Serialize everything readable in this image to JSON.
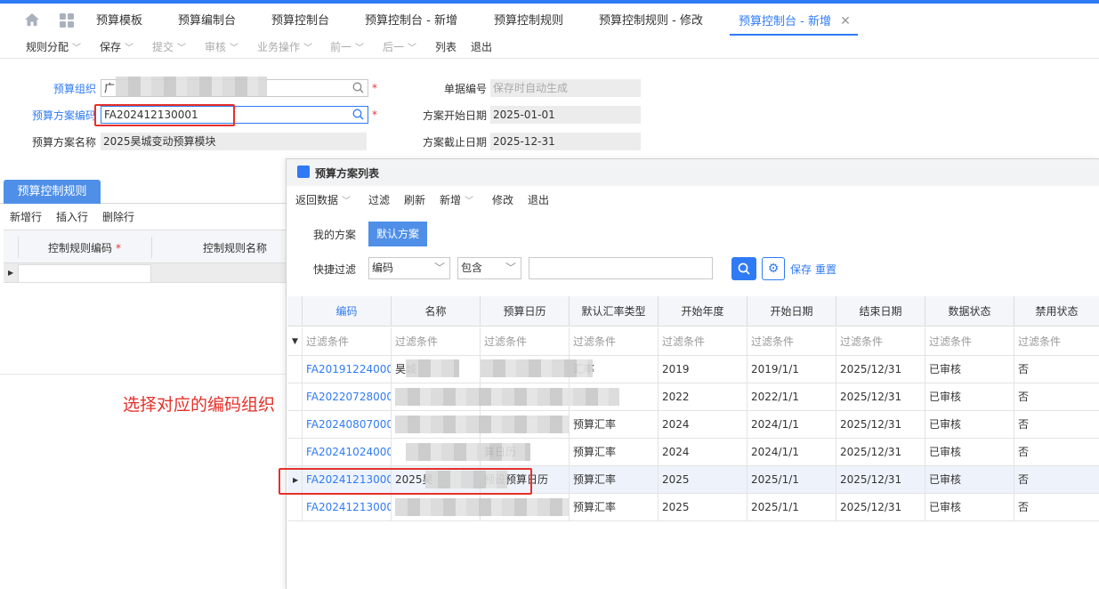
{
  "tabs": [
    {
      "label": "预算模板"
    },
    {
      "label": "预算编制台"
    },
    {
      "label": "预算控制台"
    },
    {
      "label": "预算控制台 - 新增"
    },
    {
      "label": "预算控制规则"
    },
    {
      "label": "预算控制规则 - 修改"
    },
    {
      "label": "预算控制台 - 新增"
    }
  ],
  "toolbar": [
    "规则分配",
    "保存",
    "提交",
    "审核",
    "业务操作",
    "前一",
    "后一",
    "列表",
    "退出"
  ],
  "form": {
    "org_label": "预算组织",
    "org_value": "广",
    "scheme_code_label": "预算方案编码",
    "scheme_code_value": "FA202412130001",
    "scheme_name_label": "预算方案名称",
    "scheme_name_value": "2025昊城变动预算模块",
    "doc_no_label": "单据编号",
    "doc_no_placeholder": "保存时自动生成",
    "start_label": "方案开始日期",
    "start_value": "2025-01-01",
    "end_label": "方案截止日期",
    "end_value": "2025-12-31"
  },
  "left_panel": {
    "tab": "预算控制规则",
    "actions": [
      "新增行",
      "插入行",
      "删除行"
    ],
    "col1": "控制规则编码",
    "col2": "控制规则名称"
  },
  "popup": {
    "title": "预算方案列表",
    "toolbar": [
      "返回数据",
      "过滤",
      "刷新",
      "新增",
      "修改",
      "退出"
    ],
    "scheme_tabs": [
      "我的方案",
      "默认方案"
    ],
    "quick_filter_label": "快捷过滤",
    "field_select": "编码",
    "op_select": "包含",
    "save_link": "保存",
    "reset_link": "重置",
    "filter_placeholder": "过滤条件",
    "columns": [
      "编码",
      "名称",
      "预算日历",
      "默认汇率类型",
      "开始年度",
      "开始日期",
      "结束日期",
      "数据状态",
      "禁用状态"
    ],
    "rows": [
      {
        "code": "FA20191224000",
        "name": "昊城",
        "cal": "",
        "rate": "汇率",
        "year": "2019",
        "start": "2019/1/1",
        "end": "2025/12/31",
        "status": "已审核",
        "disabled": "否"
      },
      {
        "code": "FA20220728000",
        "name": "",
        "cal": "",
        "rate": "",
        "year": "2022",
        "start": "2022/1/1",
        "end": "2025/12/31",
        "status": "已审核",
        "disabled": "否"
      },
      {
        "code": "FA20240807000",
        "name": "",
        "cal": "",
        "rate": "预算汇率",
        "year": "2024",
        "start": "2024/1/1",
        "end": "2025/12/31",
        "status": "已审核",
        "disabled": "否"
      },
      {
        "code": "FA20241024000",
        "name": "",
        "cal": "算日历",
        "rate": "预算汇率",
        "year": "2024",
        "start": "2024/1/1",
        "end": "2025/12/31",
        "status": "已审核",
        "disabled": "否"
      },
      {
        "code": "FA20241213000",
        "name": "2025昊",
        "cal": "预设预算日历",
        "rate": "预算汇率",
        "year": "2025",
        "start": "2025/1/1",
        "end": "2025/12/31",
        "status": "已审核",
        "disabled": "否"
      },
      {
        "code": "FA20241213000",
        "name": "",
        "cal": "",
        "rate": "预算汇率",
        "year": "2025",
        "start": "2025/1/1",
        "end": "2025/12/31",
        "status": "已审核",
        "disabled": "否"
      }
    ]
  },
  "annotation": "选择对应的编码组织",
  "colors": {
    "accent": "#2f7bf5",
    "highlight": "#e6302a",
    "tab_active": "#4f8fe8"
  }
}
